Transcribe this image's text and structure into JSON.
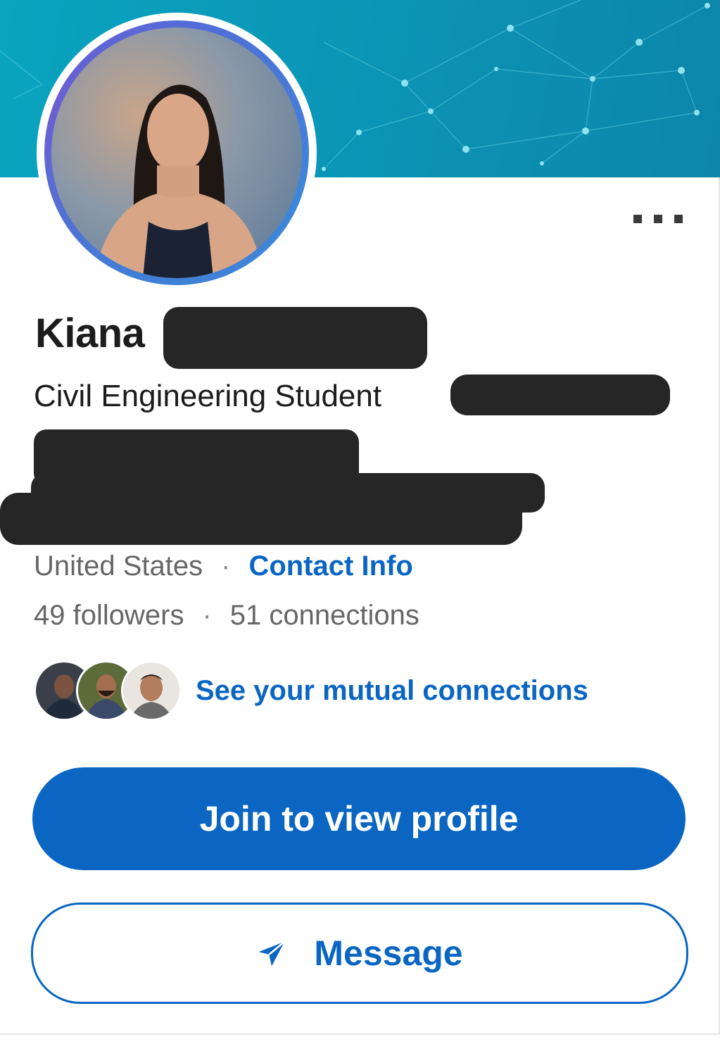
{
  "profile": {
    "first_name": "Kiana",
    "headline": "Civil Engineering Student",
    "location": "United States",
    "contact_link": "Contact Info",
    "followers": "49 followers",
    "connections": "51 connections",
    "separator": "·"
  },
  "mutual": {
    "link_text": "See your mutual connections",
    "faces": [
      "person-1",
      "person-2",
      "person-3"
    ]
  },
  "actions": {
    "join_label": "Join to view profile",
    "message_label": "Message"
  },
  "icons": {
    "more": "more-horizontal-icon",
    "message": "send-icon"
  },
  "colors": {
    "accent": "#0a66c2",
    "banner": "#0b96b7",
    "text_primary": "#1c1c1c",
    "text_secondary": "#666666",
    "redaction": "#262626"
  }
}
